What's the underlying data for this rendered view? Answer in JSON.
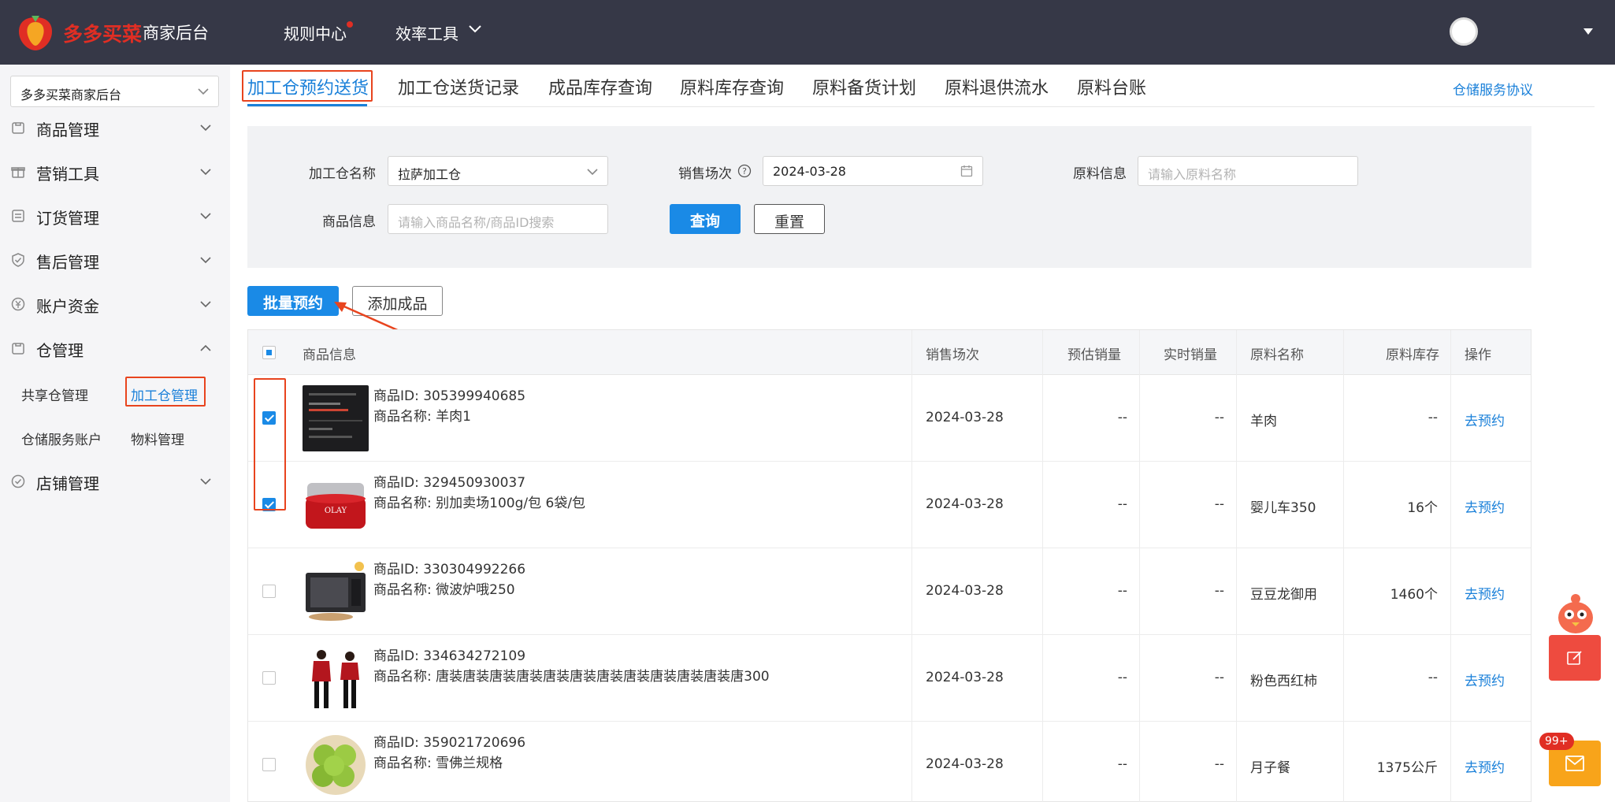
{
  "header": {
    "brand": "多多买菜",
    "brand_sub": "商家后台",
    "nav": [
      "规则中心",
      "效率工具"
    ],
    "icons": {
      "logo": "carrot-logo-icon",
      "dropdown": "chevron-down-icon",
      "avatar": "user-avatar"
    }
  },
  "sidebar": {
    "store_select": "多多买菜商家后台",
    "menus": [
      {
        "label": "商品管理",
        "icon": "goods-icon",
        "expanded": false
      },
      {
        "label": "营销工具",
        "icon": "gift-icon",
        "expanded": false
      },
      {
        "label": "订货管理",
        "icon": "order-icon",
        "expanded": false
      },
      {
        "label": "售后管理",
        "icon": "shield-icon",
        "expanded": false
      },
      {
        "label": "账户资金",
        "icon": "yuan-coin-icon",
        "expanded": false
      },
      {
        "label": "仓管理",
        "icon": "warehouse-icon",
        "expanded": true
      },
      {
        "label": "店铺管理",
        "icon": "store-check-icon",
        "expanded": false
      }
    ],
    "warehouse_submenu": [
      "共享仓管理",
      "加工仓管理",
      "仓储服务账户",
      "物料管理"
    ],
    "active_submenu": "加工仓管理"
  },
  "tabs": {
    "items": [
      "加工仓预约送货",
      "加工仓送货记录",
      "成品库存查询",
      "原料库存查询",
      "原料备货计划",
      "原料退供流水",
      "原料台账"
    ],
    "active": "加工仓预约送货",
    "right_link": "仓储服务协议"
  },
  "filters": {
    "warehouse_label": "加工仓名称",
    "warehouse_value": "拉萨加工仓",
    "session_label": "销售场次",
    "session_value": "2024-03-28",
    "material_label": "原料信息",
    "material_placeholder": "请输入原料名称",
    "goods_label": "商品信息",
    "goods_placeholder": "请输入商品名称/商品ID搜索",
    "query_button": "查询",
    "reset_button": "重置"
  },
  "actions": {
    "batch_button": "批量预约",
    "add_button": "添加成品"
  },
  "table": {
    "headers": [
      "商品信息",
      "销售场次",
      "预估销量",
      "实时销量",
      "原料名称",
      "原料库存",
      "操作"
    ],
    "rows": [
      {
        "checked": true,
        "id": "商品ID: 305399940685",
        "name": "商品名称: 羊肉1",
        "session": "2024-03-28",
        "est": "--",
        "real": "--",
        "material": "羊肉",
        "stock": "--",
        "action": "去预约",
        "thumb": "screenshot-thumbnail"
      },
      {
        "checked": true,
        "id": "商品ID: 329450930037",
        "name": "商品名称: 别加卖场100g/包 6袋/包",
        "session": "2024-03-28",
        "est": "--",
        "real": "--",
        "material": "婴儿车350",
        "stock": "16个",
        "action": "去预约",
        "thumb": "red-cream-jar-thumbnail"
      },
      {
        "checked": false,
        "id": "商品ID: 330304992266",
        "name": "商品名称: 微波炉哦250",
        "session": "2024-03-28",
        "est": "--",
        "real": "--",
        "material": "豆豆龙御用",
        "stock": "1460个",
        "action": "去预约",
        "thumb": "microwave-thumbnail"
      },
      {
        "checked": false,
        "id": "商品ID: 334634272109",
        "name": "商品名称: 唐装唐装唐装唐装唐装唐装唐装唐装唐装唐装唐装唐300",
        "session": "2024-03-28",
        "est": "--",
        "real": "--",
        "material": "粉色西红柿",
        "stock": "--",
        "action": "去预约",
        "thumb": "tang-costume-thumbnail"
      },
      {
        "checked": false,
        "id": "商品ID: 359021720696",
        "name": "商品名称: 雪佛兰规格",
        "session": "2024-03-28",
        "est": "--",
        "real": "--",
        "material": "月子餐",
        "stock": "1375公斤",
        "action": "去预约",
        "thumb": "green-apples-thumbnail"
      }
    ]
  },
  "floating": {
    "badge": "99+",
    "feedback_icon": "edit-icon",
    "mail_icon": "mail-icon"
  },
  "colors": {
    "accent": "#1a8ae6",
    "brand_red": "#e02e24",
    "annotation": "#e8441e",
    "topbar": "#363847"
  }
}
